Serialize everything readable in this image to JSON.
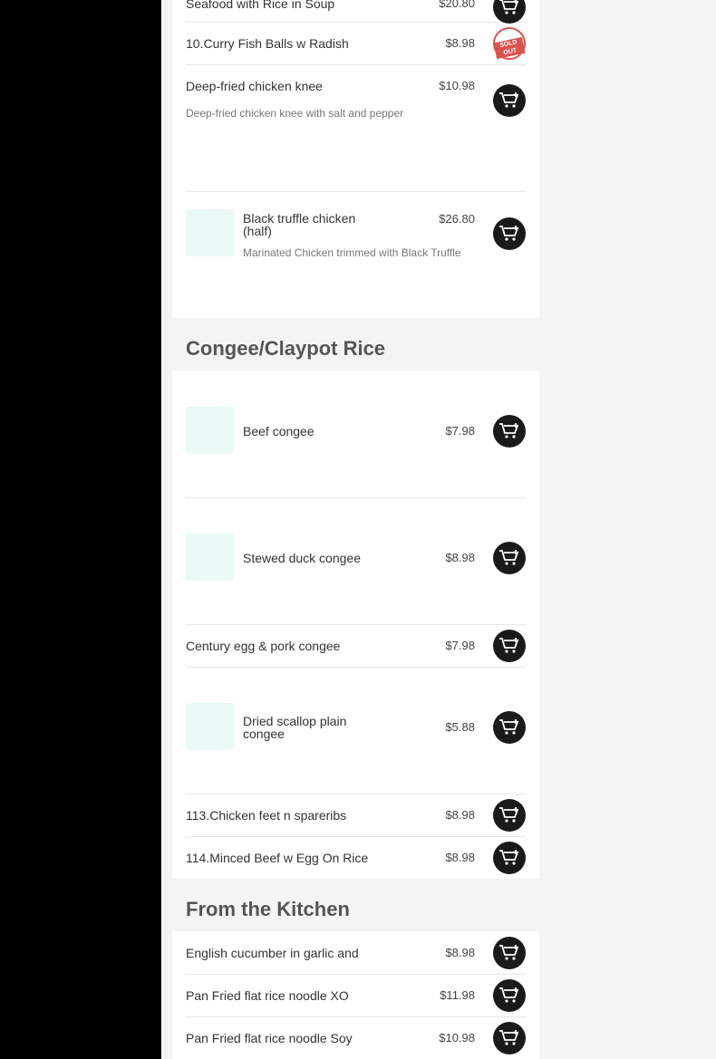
{
  "sections": [
    {
      "items": [
        {
          "name": "Seafood with Rice in Soup",
          "price": "$20.80"
        },
        {
          "name": "10.Curry Fish Balls w Radish",
          "price": "$8.98",
          "status": "SOLD OUT"
        },
        {
          "name": "Deep-fried chicken knee",
          "price": "$10.98",
          "description": "Deep-fried chicken knee with salt and pepper"
        },
        {
          "name": "Black truffle chicken (half)",
          "price": "$26.80",
          "description": "Marinated Chicken trimmed with Black Truffle"
        }
      ]
    },
    {
      "title": "Congee/Claypot Rice",
      "items": [
        {
          "name": "Beef congee",
          "price": "$7.98"
        },
        {
          "name": "Stewed duck congee",
          "price": "$8.98"
        },
        {
          "name": "Century egg & pork congee",
          "price": "$7.98"
        },
        {
          "name": "Dried scallop plain congee",
          "price": "$5.88"
        },
        {
          "name": "113.Chicken feet n spareribs",
          "price": "$8.98"
        },
        {
          "name": "114.Minced Beef w Egg On Rice",
          "price": "$8.98"
        }
      ]
    },
    {
      "title": "From the Kitchen",
      "items": [
        {
          "name": "English cucumber in garlic and",
          "price": "$8.98"
        },
        {
          "name": "Pan Fried flat rice noodle XO",
          "price": "$11.98"
        },
        {
          "name": "Pan Fried flat rice noodle Soy",
          "price": "$10.98"
        }
      ]
    }
  ],
  "icons": {
    "cart": "add-to-cart-icon",
    "soldout": "sold-out-badge"
  },
  "colors": {
    "sidebar": "#000000",
    "background": "#f4f4f4",
    "card": "#ffffff",
    "thumbnail": "#eaf9f5",
    "cart": "#1a1a1a",
    "soldout": "#d9534f"
  }
}
